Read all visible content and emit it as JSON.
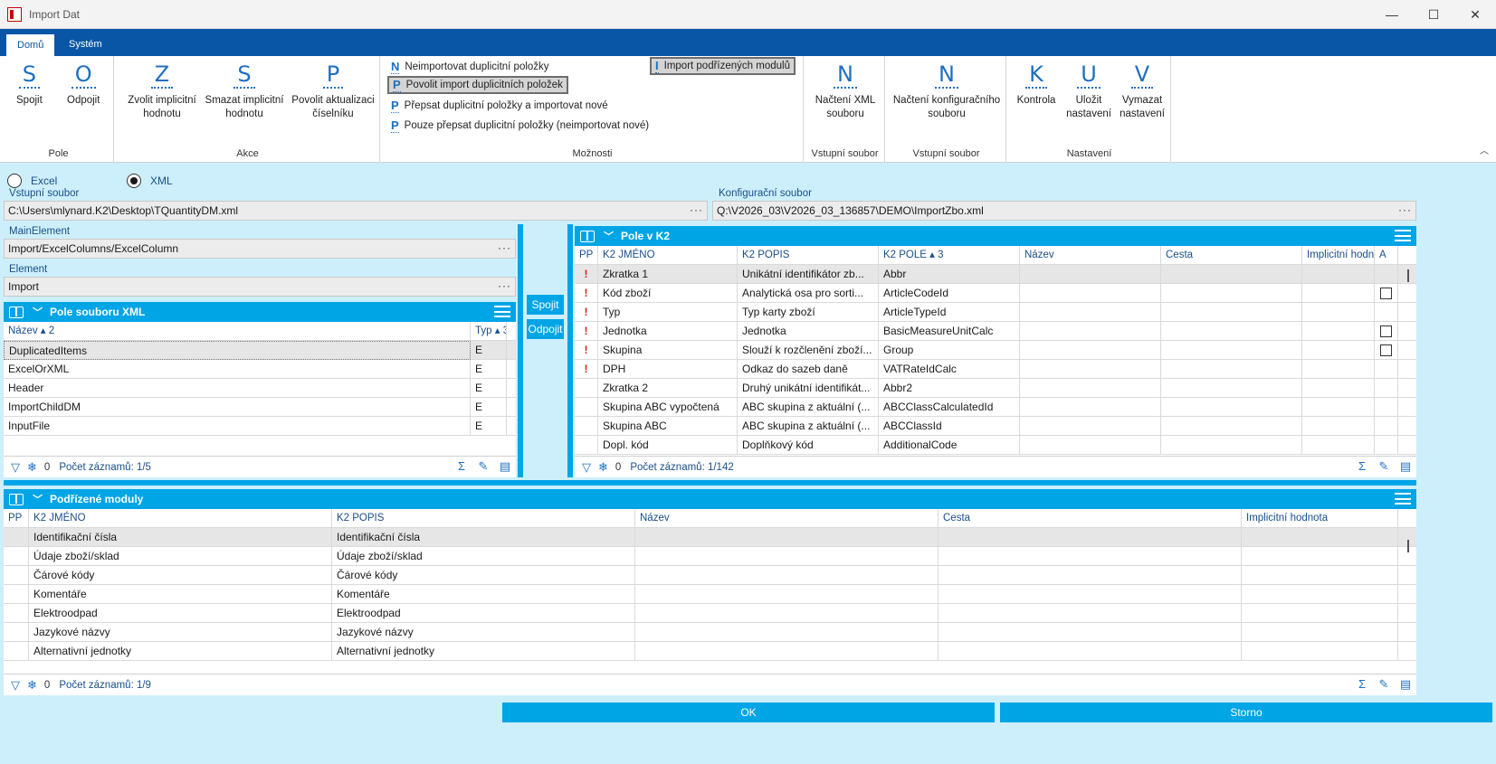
{
  "window": {
    "title": "Import Dat",
    "minimize": "—",
    "maximize": "☐",
    "close": "✕"
  },
  "ribbon": {
    "tabs": [
      "Domů",
      "Systém"
    ],
    "groups": {
      "pole": {
        "label": "Pole",
        "buttons": [
          {
            "letter": "S",
            "label": "Spojit"
          },
          {
            "letter": "O",
            "label": "Odpojit"
          }
        ]
      },
      "akce": {
        "label": "Akce",
        "buttons": [
          {
            "letter": "Z",
            "label1": "Zvolit implicitní",
            "label2": "hodnotu"
          },
          {
            "letter": "S",
            "label1": "Smazat implicitní",
            "label2": "hodnotu"
          },
          {
            "letter": "P",
            "label1": "Povolit aktualizaci",
            "label2": "číselníku"
          }
        ]
      },
      "moznosti": {
        "label": "Možnosti",
        "options": [
          {
            "letter": "N",
            "label": "Neimportovat duplicitní položky"
          },
          {
            "letter": "P",
            "label": "Povolit import duplicitních položek"
          },
          {
            "letter": "P",
            "label": "Přepsat duplicitní položky a importovat nové"
          },
          {
            "letter": "P",
            "label": "Pouze přepsat duplicitní položky (neimportovat nové)"
          }
        ],
        "sub_option": {
          "letter": "I",
          "label": "Import podřízených modulů"
        }
      },
      "vstup1": {
        "label": "Vstupní soubor",
        "button": {
          "letter": "N",
          "label1": "Načtení XML",
          "label2": "souboru"
        }
      },
      "vstup2": {
        "label": "Vstupní soubor",
        "button": {
          "letter": "N",
          "label1": "Načtení konfiguračního",
          "label2": "souboru"
        }
      },
      "nastaveni": {
        "label": "Nastavení",
        "buttons": [
          {
            "letter": "K",
            "label1": "Kontrola",
            "label2": ""
          },
          {
            "letter": "U",
            "label1": "Uložit",
            "label2": "nastavení"
          },
          {
            "letter": "V",
            "label1": "Vymazat",
            "label2": "nastavení"
          }
        ]
      }
    }
  },
  "format": {
    "excel": "Excel",
    "xml": "XML",
    "selected": "XML"
  },
  "fields": {
    "input_label": "Vstupní soubor",
    "input_value": "C:\\Users\\mlynard.K2\\Desktop\\TQuantityDM.xml",
    "config_label": "Konfigurační soubor",
    "config_value": "Q:\\V2026_03\\V2026_03_136857\\DEMO\\ImportZbo.xml",
    "main_label": "MainElement",
    "main_value": "Import/ExcelColumns/ExcelColumn",
    "element_label": "Element",
    "element_value": "Import",
    "ellipsis": "···"
  },
  "xml_panel": {
    "title": "Pole souboru XML",
    "columns": [
      "Název ▴ 2",
      "Typ ▴ 3"
    ],
    "rows": [
      [
        "DuplicatedItems",
        "E"
      ],
      [
        "ExcelOrXML",
        "E"
      ],
      [
        "Header",
        "E"
      ],
      [
        "ImportChildDM",
        "E"
      ],
      [
        "InputFile",
        "E"
      ]
    ],
    "filter_count": "0",
    "record_count": "Počet záznamů: 1/5"
  },
  "middle": {
    "connect": "Spojit",
    "disconnect": "Odpojit"
  },
  "k2_panel": {
    "title": "Pole v K2",
    "columns": [
      "PP",
      "K2 JMÉNO",
      "K2 POPIS",
      "K2 POLE ▴ 3",
      "Název",
      "Cesta",
      "Implicitní hodn",
      "A"
    ],
    "rows": [
      {
        "pp": "!",
        "name": "Zkratka 1",
        "desc": "Unikátní identifikátor zb...",
        "field": "Abbr",
        "chk": false
      },
      {
        "pp": "!",
        "name": "Kód zboží",
        "desc": "Analytická osa pro sorti...",
        "field": "ArticleCodeId",
        "chk": true
      },
      {
        "pp": "!",
        "name": "Typ",
        "desc": "Typ karty zboží",
        "field": "ArticleTypeId",
        "chk": false
      },
      {
        "pp": "!",
        "name": "Jednotka",
        "desc": "Jednotka",
        "field": "BasicMeasureUnitCalc",
        "chk": true
      },
      {
        "pp": "!",
        "name": "Skupina",
        "desc": "Slouží k rozčlenění zboží...",
        "field": "Group",
        "chk": true
      },
      {
        "pp": "!",
        "name": "DPH",
        "desc": "Odkaz do sazeb daně",
        "field": "VATRateIdCalc",
        "chk": false
      },
      {
        "pp": "",
        "name": "Zkratka 2",
        "desc": "Druhý unikátní identifikát...",
        "field": "Abbr2",
        "chk": false
      },
      {
        "pp": "",
        "name": "Skupina ABC vypočtená",
        "desc": "ABC skupina z aktuální (...",
        "field": "ABCClassCalculatedId",
        "chk": false
      },
      {
        "pp": "",
        "name": "Skupina ABC",
        "desc": "ABC skupina z aktuální (...",
        "field": "ABCClassId",
        "chk": false
      },
      {
        "pp": "",
        "name": "Dopl. kód",
        "desc": "Doplňkový kód",
        "field": "AdditionalCode",
        "chk": false
      }
    ],
    "filter_count": "0",
    "record_count": "Počet záznamů: 1/142"
  },
  "sub_panel": {
    "title": "Podřízené moduly",
    "columns": [
      "PP",
      "K2 JMÉNO",
      "K2 POPIS",
      "Název",
      "Cesta",
      "Implicitní hodnota"
    ],
    "rows": [
      [
        "Identifikační čísla",
        "Identifikační čísla"
      ],
      [
        "Údaje zboží/sklad",
        "Údaje zboží/sklad"
      ],
      [
        "Čárové kódy",
        "Čárové kódy"
      ],
      [
        "Komentáře",
        "Komentáře"
      ],
      [
        "Elektroodpad",
        "Elektroodpad"
      ],
      [
        "Jazykové názvy",
        "Jazykové názvy"
      ],
      [
        "Alternativní jednotky",
        "Alternativní jednotky"
      ]
    ],
    "filter_count": "0",
    "record_count": "Počet záznamů: 1/9"
  },
  "bottom": {
    "ok": "OK",
    "cancel": "Storno"
  },
  "colors": {
    "accent": "#00a5e6",
    "ribbon_tabs": "#0a56a6",
    "background": "#cdeffc",
    "required": "#e01b1b"
  }
}
